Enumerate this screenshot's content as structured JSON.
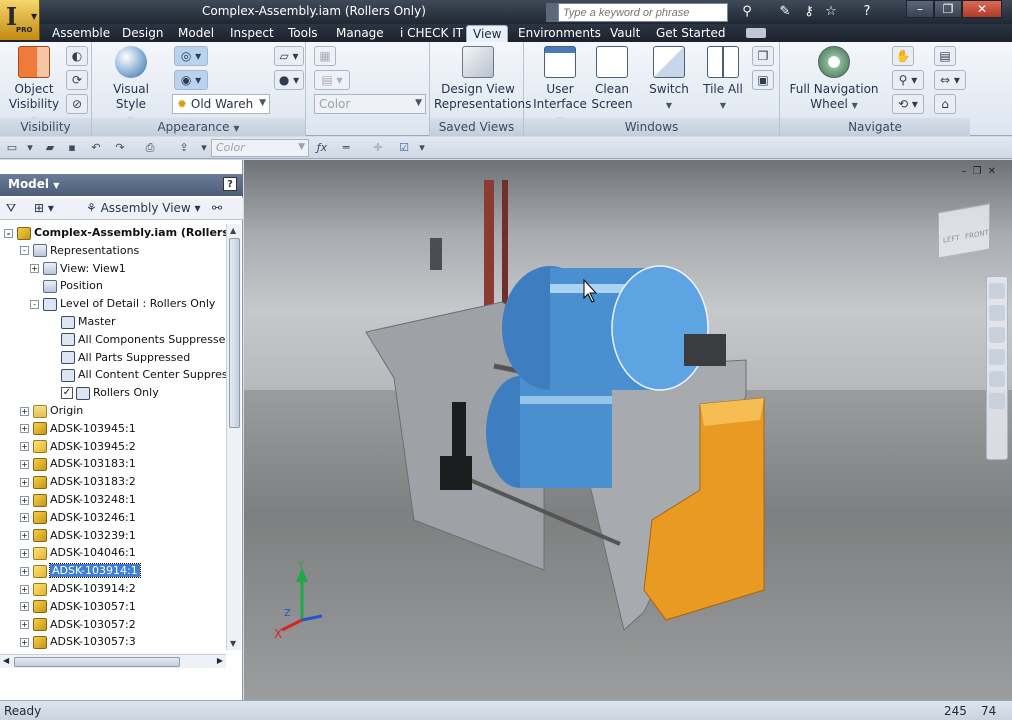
{
  "window": {
    "title": "Complex-Assembly.iam (Rollers Only)",
    "search_placeholder": "Type a keyword or phrase",
    "app_badge": "PRO"
  },
  "ribbon_tabs": [
    "Assemble",
    "Design",
    "Model",
    "Inspect",
    "Tools",
    "Manage",
    "i CHECK IT",
    "View",
    "Environments",
    "Vault",
    "Get Started"
  ],
  "active_tab": "View",
  "ribbon": {
    "visibility": {
      "title": "Visibility",
      "object_visibility": "Object Visibility"
    },
    "appearance": {
      "title": "Appearance",
      "visual_style": "Visual Style",
      "lighting_combo": "Old Wareh",
      "color_combo": "Color"
    },
    "saved_views": {
      "title": "Saved Views",
      "design_view": "Design View Representations"
    },
    "windows": {
      "title": "Windows",
      "user_interface": "User Interface",
      "clean_screen": "Clean Screen",
      "switch": "Switch",
      "tile_all": "Tile All"
    },
    "navigate": {
      "title": "Navigate",
      "full_nav_wheel": "Full Navigation Wheel"
    }
  },
  "qat": {
    "color_combo": "Color"
  },
  "browser": {
    "title": "Model",
    "view_combo": "Assembly View",
    "tree": [
      {
        "label": "Complex-Assembly.iam (Rollers On",
        "level": 0,
        "icon": "asm",
        "expander": "-",
        "root": true
      },
      {
        "label": "Representations",
        "level": 1,
        "icon": "rep",
        "expander": "-"
      },
      {
        "label": "View: View1",
        "level": 2,
        "icon": "rep",
        "expander": "+"
      },
      {
        "label": "Position",
        "level": 2,
        "icon": "rep",
        "expander": ""
      },
      {
        "label": "Level of Detail : Rollers Only",
        "level": 2,
        "icon": "lod",
        "expander": "-"
      },
      {
        "label": "Master",
        "level": 3,
        "icon": "lod",
        "expander": ""
      },
      {
        "label": "All Components Suppressed",
        "level": 3,
        "icon": "lod",
        "expander": ""
      },
      {
        "label": "All Parts Suppressed",
        "level": 3,
        "icon": "lod",
        "expander": ""
      },
      {
        "label": "All Content Center Suppresse",
        "level": 3,
        "icon": "lod",
        "expander": ""
      },
      {
        "label": "Rollers Only",
        "level": 3,
        "icon": "lod",
        "expander": "",
        "checked": true
      },
      {
        "label": "Origin",
        "level": 1,
        "icon": "folder",
        "expander": "+"
      },
      {
        "label": "ADSK-103945:1",
        "level": 1,
        "icon": "asm",
        "expander": "+"
      },
      {
        "label": "ADSK-103945:2",
        "level": 1,
        "icon": "part",
        "expander": "+"
      },
      {
        "label": "ADSK-103183:1",
        "level": 1,
        "icon": "asm",
        "expander": "+"
      },
      {
        "label": "ADSK-103183:2",
        "level": 1,
        "icon": "asm",
        "expander": "+"
      },
      {
        "label": "ADSK-103248:1",
        "level": 1,
        "icon": "asm",
        "expander": "+"
      },
      {
        "label": "ADSK-103246:1",
        "level": 1,
        "icon": "asm",
        "expander": "+"
      },
      {
        "label": "ADSK-103239:1",
        "level": 1,
        "icon": "asm",
        "expander": "+"
      },
      {
        "label": "ADSK-104046:1",
        "level": 1,
        "icon": "part",
        "expander": "+"
      },
      {
        "label": "ADSK-103914:1",
        "level": 1,
        "icon": "part",
        "expander": "+",
        "selected": true
      },
      {
        "label": "ADSK-103914:2",
        "level": 1,
        "icon": "part",
        "expander": "+"
      },
      {
        "label": "ADSK-103057:1",
        "level": 1,
        "icon": "asm",
        "expander": "+"
      },
      {
        "label": "ADSK-103057:2",
        "level": 1,
        "icon": "asm",
        "expander": "+"
      },
      {
        "label": "ADSK-103057:3",
        "level": 1,
        "icon": "asm",
        "expander": "+"
      }
    ]
  },
  "viewcube": {
    "face_left": "LEFT",
    "face_front": "FRONT"
  },
  "status": {
    "text": "Ready",
    "count1": "245",
    "count2": "74"
  },
  "colors": {
    "roller_blue": "#4a8fd0",
    "guard_orange": "#e89a22",
    "frame_grey": "#9da0a4"
  }
}
